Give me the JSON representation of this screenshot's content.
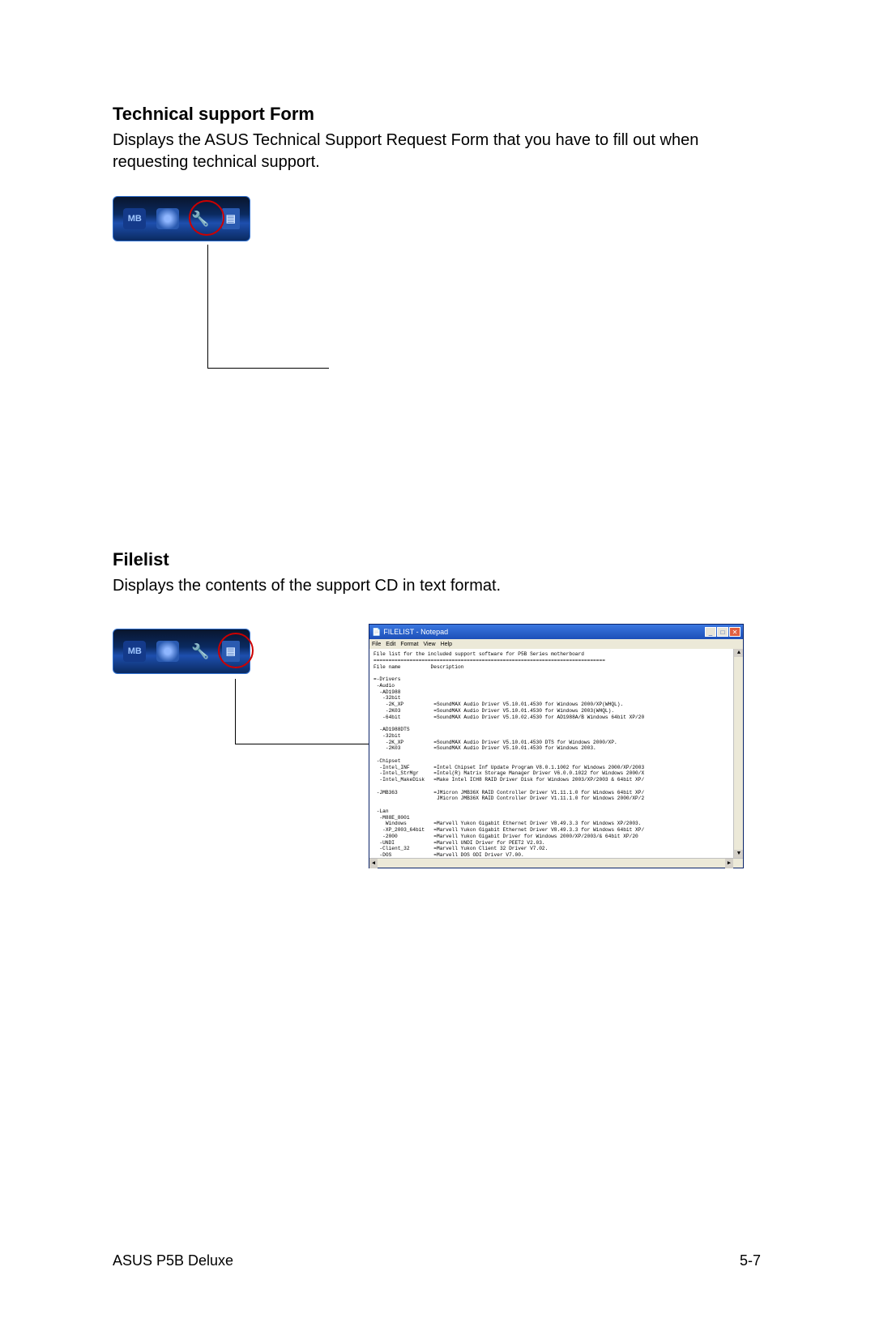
{
  "section1": {
    "title": "Technical support Form",
    "body": "Displays the ASUS Technical Support Request Form that you have to fill out when requesting technical support."
  },
  "section2": {
    "title": "Filelist",
    "body": "Displays the contents of the support CD in text format."
  },
  "toolbar": {
    "mb_label": "MB"
  },
  "notepad": {
    "title": "FILELIST - Notepad",
    "menu": [
      "File",
      "Edit",
      "Format",
      "View",
      "Help"
    ],
    "content": "File list for the included support software for P5B Series motherboard\n=============================================================================\nFile name          Description\n\n=-Drivers\n -Audio\n  -AD1988\n   -32bit\n    -2K_XP          =SoundMAX Audio Driver V5.10.01.4530 for Windows 2000/XP(WHQL).\n    -2K03           =SoundMAX Audio Driver V5.10.01.4530 for Windows 2003(WHQL).\n   -64bit           =SoundMAX Audio Driver V5.10.02.4530 for AD1988A/B Windows 64bit XP/20\n\n  -AD1988DTS\n   -32bit\n    -2K_XP          =SoundMAX Audio Driver V5.10.01.4530 DTS for Windows 2000/XP.\n    -2K03           =SoundMAX Audio Driver V5.10.01.4530 for Windows 2003.\n\n -Chipset\n  -Intel_INF        =Intel Chipset Inf Update Program V8.0.1.1002 for Windows 2000/XP/2003\n  -Intel_StrMgr     =Intel(R) Matrix Storage Manager Driver V6.0.0.1022 for Windows 2000/X\n  -Intel_MakeDisk   =Make Intel ICH8 RAID Driver Disk for Windows 2003/XP/2003 & 64bit XP/\n\n -JMB363            =JMicron JMB36X RAID Controller Driver V1.11.1.0 for Windows 64bit XP/\n                     JMicron JMB36X RAID Controller Driver V1.11.1.0 for Windows 2000/XP/2\n\n -Lan\n  -M88E_8001\n    Windows         =Marvell Yukon Gigabit Ethernet Driver V8.49.3.3 for Windows XP/2003.\n   -XP_2003_64bit   =Marvell Yukon Gigabit Ethernet Driver V8.49.3.3 for Windows 64bit XP/\n   -2000            =Marvell Yukon Gigabit Driver for Windows 2000/XP/2003/& 64bit XP/20\n  -UNDI             =Marvell UNDI Driver for PEET2 V2.03.\n  -Client_32        =Marvell Yukon Client 32 Driver V7.02.\n  -DOS              =Marvell DOS ODI Driver V7.00."
  },
  "footer": {
    "left": "ASUS P5B Deluxe",
    "right": "5-7"
  }
}
